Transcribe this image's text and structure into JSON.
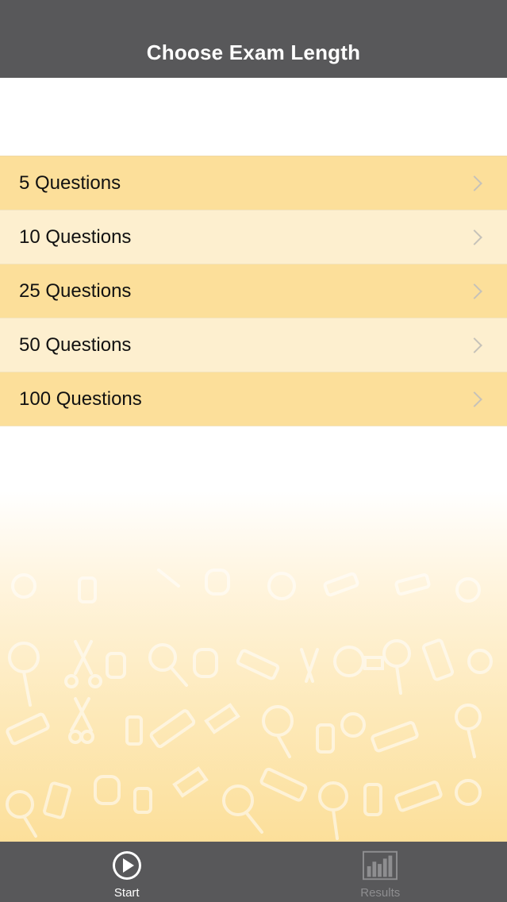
{
  "nav": {
    "title": "Choose Exam Length"
  },
  "list": {
    "items": [
      {
        "label": "5 Questions"
      },
      {
        "label": "10 Questions"
      },
      {
        "label": "25 Questions"
      },
      {
        "label": "50 Questions"
      },
      {
        "label": "100 Questions"
      }
    ]
  },
  "tabs": {
    "start": {
      "label": "Start",
      "icon": "play-icon"
    },
    "results": {
      "label": "Results",
      "icon": "bar-chart-icon"
    }
  },
  "colors": {
    "nav_bg": "#58585a",
    "row_odd": "#fcdf9a",
    "row_even": "#fdefcf",
    "tab_active": "#ffffff",
    "tab_inactive": "#8e8e90"
  }
}
